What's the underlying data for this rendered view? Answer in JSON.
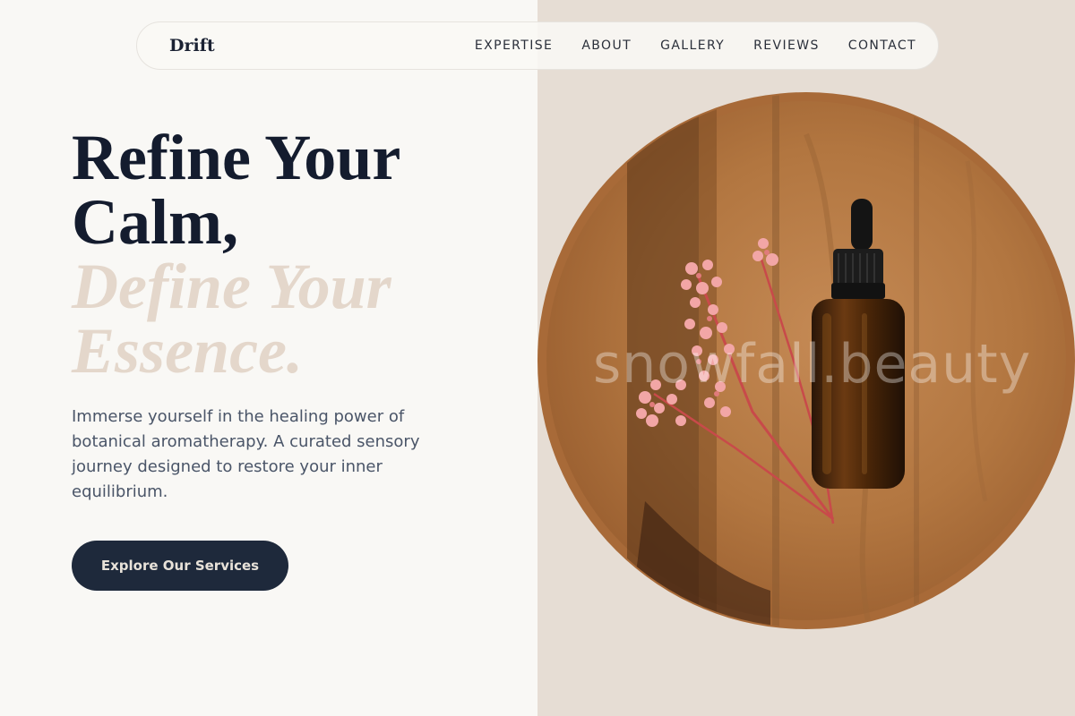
{
  "brand": {
    "name": "Drift"
  },
  "nav": {
    "items": [
      {
        "label": "EXPERTISE"
      },
      {
        "label": "ABOUT"
      },
      {
        "label": "GALLERY"
      },
      {
        "label": "REVIEWS"
      },
      {
        "label": "CONTACT"
      }
    ]
  },
  "hero": {
    "headline_line1": "Refine Your",
    "headline_line2": "Calm,",
    "headline_line3": "Define Your",
    "headline_line4": "Essence.",
    "description": "Immerse yourself in the healing power of botanical aromatherapy. A curated sensory journey designed to restore your inner equilibrium.",
    "cta_label": "Explore Our Services"
  },
  "image": {
    "watermark": "snowfall.beauty",
    "subject": "amber dropper bottle with pink dried flowers on round wooden tray"
  },
  "colors": {
    "dark_navy": "#141c2e",
    "accent_beige": "#e4d7cb",
    "button_bg": "#1e293b",
    "page_bg": "#f9f8f5"
  }
}
